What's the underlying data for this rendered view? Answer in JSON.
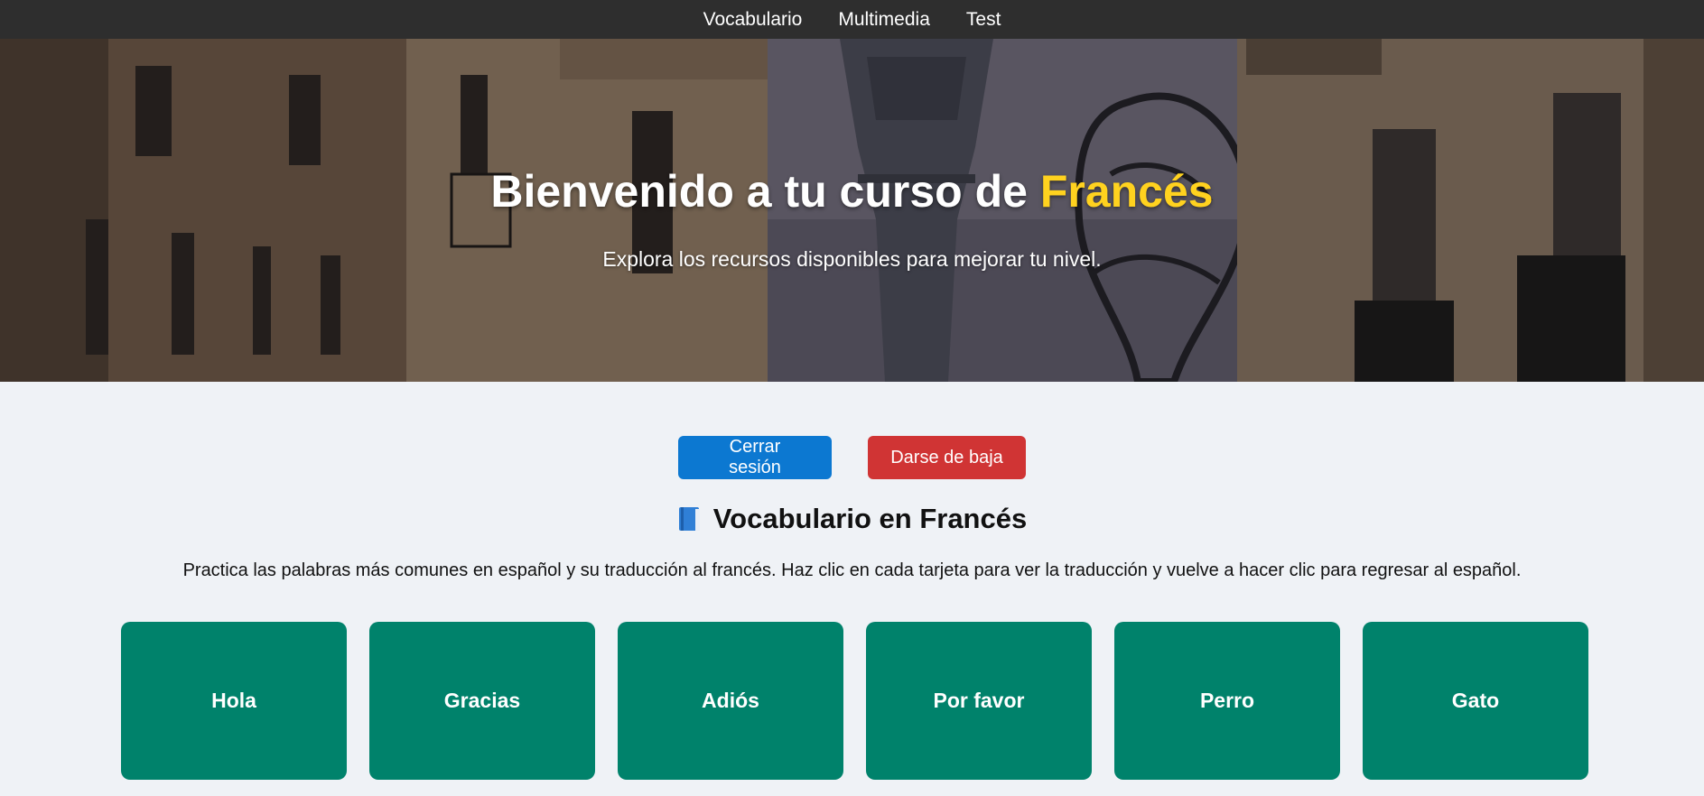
{
  "nav": {
    "items": [
      {
        "label": "Vocabulario"
      },
      {
        "label": "Multimedia"
      },
      {
        "label": "Test"
      }
    ]
  },
  "hero": {
    "title_prefix": "Bienvenido a tu curso de ",
    "title_accent": "Francés",
    "subtitle": "Explora los recursos disponibles para mejorar tu nivel."
  },
  "actions": {
    "logout_label": "Cerrar sesión",
    "unsubscribe_label": "Darse de baja"
  },
  "section": {
    "icon": "book-icon",
    "title": "Vocabulario en Francés",
    "description": "Practica las palabras más comunes en español y su traducción al francés. Haz clic en cada tarjeta para ver la traducción y vuelve a hacer clic para regresar al español."
  },
  "cards": [
    {
      "label": "Hola"
    },
    {
      "label": "Gracias"
    },
    {
      "label": "Adiós"
    },
    {
      "label": "Por favor"
    },
    {
      "label": "Perro"
    },
    {
      "label": "Gato"
    }
  ],
  "colors": {
    "nav_bg": "#2e2e2e",
    "accent_yellow": "#ffd21f",
    "button_blue": "#0c78d1",
    "button_red": "#d03434",
    "card_green": "#00826b",
    "page_bg": "#eff2f6"
  }
}
